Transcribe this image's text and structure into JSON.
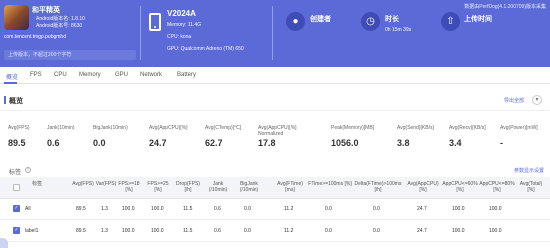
{
  "header": {
    "app": {
      "name": "和平精英",
      "android_version": "Android版本名: 1.8.10",
      "android_code": "Android版本号: 8630",
      "package": "com.tencent.tmgp.pubgmhd",
      "note": "上传版本，不超过200个字符"
    },
    "device": {
      "name": "V2024A",
      "memory": "Memory: 11.4G",
      "cpu": "CPU: kona",
      "gpu": "GPU: Qualcomm Adreno (TM) 650"
    },
    "creator": {
      "title": "创建者",
      "value": "",
      "icon": "user-icon"
    },
    "duration": {
      "title": "时长",
      "value": "0h 15m 39s",
      "icon": "clock-icon"
    },
    "upload": {
      "title": "上传时间",
      "value": "",
      "icon": "upload-icon"
    },
    "version_text": "数据由PerfDog(4.1.200709)版本采集"
  },
  "colors": {
    "brand": "#5b6ad6",
    "header_bg": "#5b6ad6",
    "icon_circle": "#3f4cb8"
  },
  "tabs": [
    "概览",
    "FPS",
    "CPU",
    "Memory",
    "GPU",
    "Network",
    "Battery"
  ],
  "overview": {
    "title": "概览",
    "export_label": "导出全部",
    "metrics": [
      {
        "label": "Avg(FPS)",
        "value": "89.5"
      },
      {
        "label": "Jank(10min)",
        "value": "0.6"
      },
      {
        "label": "BigJank(10min)",
        "value": "0.0"
      },
      {
        "label": "Avg(AppCPU)[%]",
        "value": "24.7"
      },
      {
        "label": "Avg(CTemp)[°C]",
        "value": "62.7"
      },
      {
        "label": "Avg(AppCPU)[%] Normalized",
        "value": "17.8"
      },
      {
        "label": "Peak(Memory)[MB]",
        "value": "1056.0"
      },
      {
        "label": "Avg(Send)[KB/s]",
        "value": "3.8"
      },
      {
        "label": "Avg(Recv)[KB/s]",
        "value": "3.4"
      },
      {
        "label": "Avg(Power)[mW]",
        "value": "-"
      }
    ]
  },
  "labels_table": {
    "title": "标签",
    "help": "?",
    "settings_label": "参数显示设置",
    "columns": [
      "标签",
      "Avg(FPS)",
      "Var(FPS)",
      "FPS>=18 [%]",
      "FPS>=25 [%]",
      "Drop(FPS) [/h]",
      "Jank (/10min)",
      "BigJank (/10min)",
      "Avg(FTime) [ms]",
      "FTime>=100ms [%]",
      "Delta(FTime)>100ms [/h]",
      "Avg(AppCPU) [%]",
      "AppCPU<=60% [%]",
      "AppCPU<=80% [%]",
      "Avg(Total) [%]"
    ],
    "rows": [
      {
        "label": "All",
        "cells": [
          "89.5",
          "1.3",
          "100.0",
          "100.0",
          "11.5",
          "0.6",
          "0.0",
          "11.2",
          "0.0",
          "0.0",
          "24.7",
          "100.0",
          "100.0",
          ""
        ]
      },
      {
        "label": "label1",
        "cells": [
          "89.5",
          "1.3",
          "100.0",
          "100.0",
          "11.5",
          "0.6",
          "0.0",
          "11.2",
          "0.0",
          "0.0",
          "24.7",
          "100.0",
          "100.0",
          ""
        ]
      }
    ]
  }
}
